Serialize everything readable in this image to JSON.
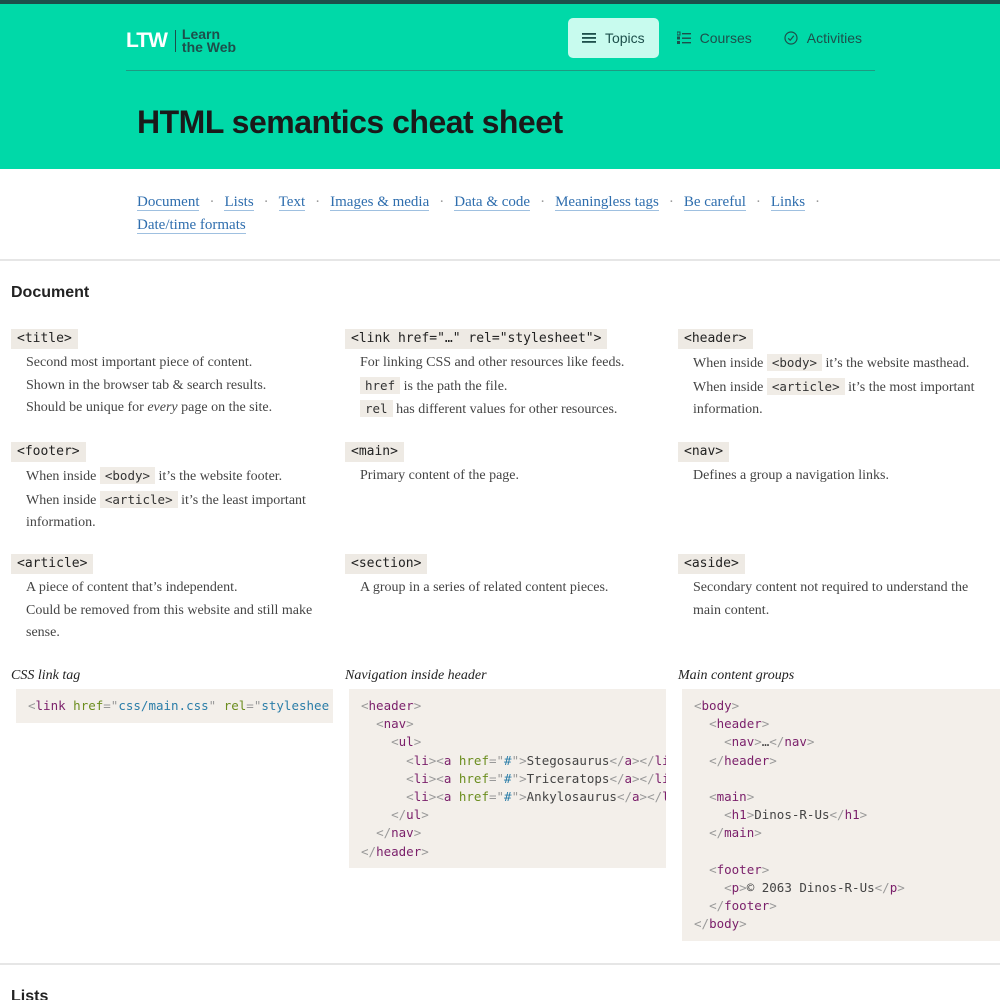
{
  "brand": {
    "mark": "LTW",
    "name_line1": "Learn",
    "name_line2": "the Web"
  },
  "nav": [
    {
      "label": "Topics",
      "icon": "menu-icon",
      "active": true
    },
    {
      "label": "Courses",
      "icon": "list-icon",
      "active": false
    },
    {
      "label": "Activities",
      "icon": "check-circle-icon",
      "active": false
    }
  ],
  "page": {
    "title": "HTML semantics cheat sheet"
  },
  "toc": {
    "row1": [
      "Document",
      "Lists",
      "Text",
      "Images & media",
      "Data & code",
      "Meaningless tags",
      "Be careful",
      "Links"
    ],
    "row2": [
      "Date/time formats"
    ],
    "separator": "·"
  },
  "section": {
    "heading": "Document",
    "next_heading": "Lists"
  },
  "cards": {
    "title": {
      "tag": "<title>",
      "l1": "Second most important piece of content.",
      "l2": "Shown in the browser tab & search results.",
      "l3a": "Should be unique for ",
      "l3b": "every",
      "l3c": " page on the site."
    },
    "link": {
      "tag": "<link href=\"…\" rel=\"stylesheet\">",
      "l1": "For linking CSS and other resources like feeds.",
      "l2code": "href",
      "l2": " is the path the file.",
      "l3code": "rel",
      "l3": " has different values for other resources."
    },
    "header": {
      "tag": "<header>",
      "l1a": "When inside ",
      "l1code": "<body>",
      "l1b": " it’s the website masthead.",
      "l2a": "When inside ",
      "l2code": "<article>",
      "l2b": " it’s the most important",
      "l3": "information."
    },
    "footer": {
      "tag": "<footer>",
      "l1a": "When inside ",
      "l1code": "<body>",
      "l1b": " it’s the website footer.",
      "l2a": "When inside ",
      "l2code": "<article>",
      "l2b": " it’s the least important",
      "l3": "information."
    },
    "main": {
      "tag": "<main>",
      "l1": "Primary content of the page."
    },
    "nav": {
      "tag": "<nav>",
      "l1": "Defines a group a navigation links."
    },
    "article": {
      "tag": "<article>",
      "l1": "A piece of content that’s independent.",
      "l2": "Could be removed from this website and still make",
      "l3": "sense."
    },
    "section": {
      "tag": "<section>",
      "l1": "A group in a series of related content pieces."
    },
    "aside": {
      "tag": "<aside>",
      "l1": "Secondary content not required to understand the",
      "l2": "main content."
    }
  },
  "examples": {
    "css": {
      "caption": "CSS link tag",
      "href": "css/main.css",
      "rel": "styleshee"
    },
    "navheader": {
      "caption": "Navigation inside header",
      "items": [
        "Stegosaurus",
        "Triceratops",
        "Ankylosaurus"
      ],
      "href": "#"
    },
    "groups": {
      "caption": "Main content groups",
      "ellipsis": "…",
      "h1": "Dinos-R-Us",
      "p": "© 2063 Dinos-R-Us"
    }
  }
}
